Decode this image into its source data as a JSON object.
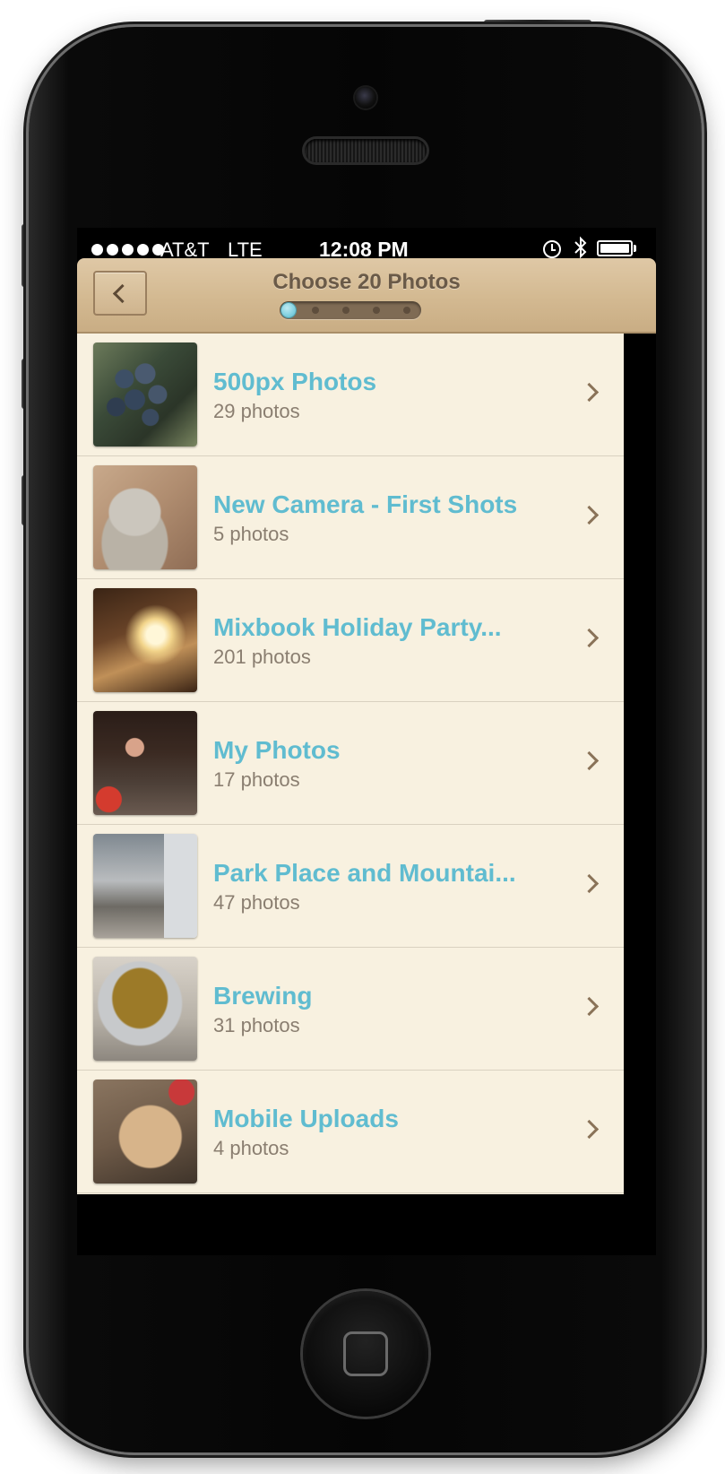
{
  "status_bar": {
    "signal_dots": 5,
    "carrier": "AT&T",
    "network": "LTE",
    "time": "12:08 PM",
    "icons": [
      "alarm-icon",
      "bluetooth-icon",
      "battery-icon"
    ]
  },
  "nav": {
    "title": "Choose 20 Photos",
    "back_icon": "chevron-left-icon",
    "progress": {
      "total_steps": 5,
      "current_step": 1
    }
  },
  "albums": [
    {
      "name": "500px Photos",
      "count": "29 photos",
      "thumb": "grapes"
    },
    {
      "name": "New Camera - First Shots",
      "count": "5 photos",
      "thumb": "cat"
    },
    {
      "name": "Mixbook Holiday Party...",
      "count": "201 photos",
      "thumb": "martini"
    },
    {
      "name": "My Photos",
      "count": "17 photos",
      "thumb": "party"
    },
    {
      "name": "Park Place and Mountai...",
      "count": "47 photos",
      "thumb": "patio"
    },
    {
      "name": "Brewing",
      "count": "31 photos",
      "thumb": "brewing"
    },
    {
      "name": "Mobile Uploads",
      "count": "4 photos",
      "thumb": "dog"
    }
  ],
  "colors": {
    "album_name": "#60bcd0",
    "album_count": "#8a7e70",
    "nav_title": "#6a5a48",
    "list_background": "#f8f1e0",
    "nav_background": "#d3b991",
    "progress_active": "#7fd0e0"
  }
}
